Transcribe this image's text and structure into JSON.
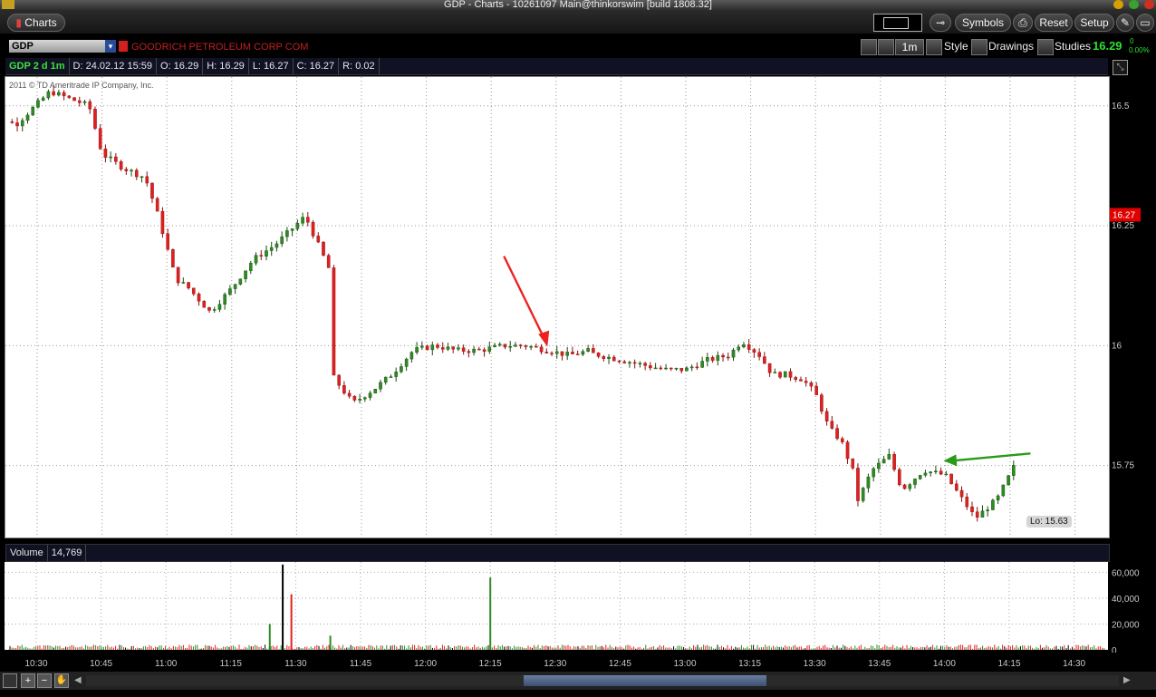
{
  "window": {
    "title": "GDP - Charts - 10261097 Main@thinkorswim [build 1808.32]"
  },
  "toolbar": {
    "app_label": "Charts",
    "buttons": [
      "Symbols",
      "Reset",
      "Setup"
    ]
  },
  "symbol_bar": {
    "symbol": "GDP",
    "company": "GOODRICH PETROLEUM CORP COM",
    "timeframe": "1m",
    "style_label": "Style",
    "drawings_label": "Drawings",
    "studies_label": "Studies",
    "last_price": "16.29",
    "change_top": "0",
    "change_pct": "0.00%"
  },
  "info_row": {
    "chart_label": "GDP 2 d 1m",
    "date": "D: 24.02.12 15:59",
    "open": "O: 16.29",
    "high": "H: 16.29",
    "low": "L: 16.27",
    "close": "C: 16.27",
    "range": "R: 0.02"
  },
  "copyright": "2011 © TD Ameritrade IP Company, Inc.",
  "price_tag": "16.27",
  "lo_label": "Lo: 15.63",
  "volume_header": {
    "label": "Volume",
    "value": "14,769"
  },
  "colors": {
    "up": "#2e8b22",
    "down": "#e02020",
    "red_arrow": "#ee2222",
    "green_arrow": "#2a9a18",
    "last_tag": "#e00000"
  },
  "chart_data": [
    {
      "type": "candlestick",
      "title": "GDP 2 d 1m",
      "x_ticks": [
        "10:30",
        "10:45",
        "11:00",
        "11:15",
        "11:30",
        "11:45",
        "12:00",
        "12:15",
        "12:30",
        "12:45",
        "13:00",
        "13:15",
        "13:30",
        "13:45",
        "14:00",
        "14:15",
        "14:30"
      ],
      "y_ticks": [
        "16.5",
        "16.25",
        "16",
        "15.75"
      ],
      "ylim": [
        15.6,
        16.56
      ],
      "xlim_minutes": [
        10.3,
        14.58
      ],
      "close_path": [
        [
          10.17,
          16.5
        ],
        [
          10.25,
          16.46
        ],
        [
          10.33,
          16.53
        ],
        [
          10.42,
          16.5
        ],
        [
          10.45,
          16.4
        ],
        [
          10.5,
          16.37
        ],
        [
          10.55,
          16.35
        ],
        [
          10.58,
          16.27
        ],
        [
          10.62,
          16.14
        ],
        [
          10.65,
          16.12
        ],
        [
          10.7,
          16.07
        ],
        [
          10.75,
          16.12
        ],
        [
          10.8,
          16.18
        ],
        [
          10.85,
          16.21
        ],
        [
          10.92,
          16.27
        ],
        [
          10.98,
          16.15
        ],
        [
          11.02,
          16.12
        ],
        [
          11.07,
          16.06
        ],
        [
          11.12,
          16.05
        ],
        [
          11.17,
          16.02
        ],
        [
          11.22,
          15.98
        ],
        [
          11.28,
          16.0
        ],
        [
          11.32,
          15.97
        ],
        [
          11.38,
          15.94
        ],
        [
          11.43,
          15.88
        ],
        [
          11.48,
          15.91
        ],
        [
          11.52,
          15.94
        ],
        [
          11.57,
          15.99
        ],
        [
          11.62,
          16.0
        ],
        [
          11.67,
          15.99
        ],
        [
          11.72,
          15.99
        ],
        [
          11.78,
          16.0
        ],
        [
          11.83,
          16.0
        ],
        [
          11.88,
          15.99
        ],
        [
          11.93,
          15.98
        ],
        [
          11.98,
          15.99
        ],
        [
          12.05,
          15.99
        ],
        [
          12.1,
          16.0
        ],
        [
          12.15,
          15.99
        ],
        [
          12.2,
          15.99
        ],
        [
          12.25,
          15.98
        ],
        [
          12.3,
          15.99
        ],
        [
          12.35,
          15.99
        ],
        [
          12.4,
          15.98
        ],
        [
          12.45,
          15.97
        ],
        [
          12.5,
          15.96
        ],
        [
          12.55,
          15.95
        ],
        [
          12.6,
          15.95
        ],
        [
          12.65,
          15.97
        ],
        [
          12.7,
          15.98
        ],
        [
          12.73,
          16.01
        ],
        [
          12.77,
          15.98
        ],
        [
          12.8,
          15.94
        ],
        [
          12.83,
          15.94
        ],
        [
          12.87,
          15.93
        ],
        [
          12.9,
          15.9
        ],
        [
          12.93,
          15.83
        ],
        [
          12.96,
          15.8
        ],
        [
          12.99,
          15.73
        ],
        [
          13.02,
          15.72
        ],
        [
          13.05,
          15.75
        ],
        [
          13.1,
          15.78
        ],
        [
          13.13,
          15.76
        ],
        [
          13.17,
          15.7
        ],
        [
          13.22,
          15.67
        ],
        [
          13.26,
          15.67
        ],
        [
          13.3,
          15.66
        ],
        [
          13.34,
          15.64
        ],
        [
          13.37,
          15.66
        ],
        [
          13.4,
          15.68
        ],
        [
          13.43,
          15.74
        ],
        [
          13.47,
          15.77
        ],
        [
          13.5,
          15.7
        ],
        [
          13.55,
          15.74
        ],
        [
          13.6,
          15.73
        ],
        [
          13.67,
          15.64
        ],
        [
          13.72,
          15.68
        ],
        [
          13.76,
          15.75
        ]
      ],
      "series": [
        {
          "name": "GDP"
        }
      ]
    },
    {
      "type": "bar",
      "title": "Volume",
      "y_ticks": [
        "60,000",
        "40,000",
        "20,000",
        "0"
      ],
      "ylim": [
        0,
        68000
      ],
      "spikes": [
        {
          "x": "11:27",
          "value": 66000,
          "color": "black"
        },
        {
          "x": "11:29",
          "value": 43000,
          "color": "red"
        },
        {
          "x": "11:24",
          "value": 20000,
          "color": "green"
        },
        {
          "x": "12:15",
          "value": 56000,
          "color": "green"
        },
        {
          "x": "11:38",
          "value": 11000,
          "color": "green"
        }
      ]
    }
  ]
}
